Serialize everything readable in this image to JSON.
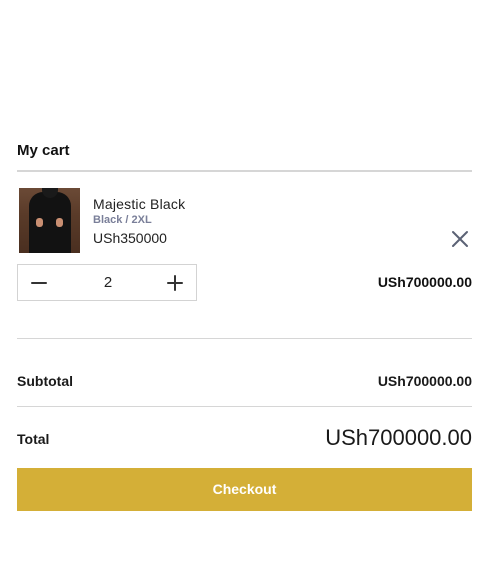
{
  "cart": {
    "title": "My cart"
  },
  "item": {
    "name": "Majestic Black",
    "variant": "Black / 2XL",
    "unit_price": "USh350000",
    "quantity": "2",
    "line_total": "USh700000.00",
    "image_icon": "product-thumbnail",
    "remove_icon": "close-icon"
  },
  "stepper": {
    "decrease_icon": "minus-icon",
    "increase_icon": "plus-icon"
  },
  "summary": {
    "subtotal_label": "Subtotal",
    "subtotal_value": "USh700000.00",
    "total_label": "Total",
    "total_value": "USh700000.00"
  },
  "checkout": {
    "label": "Checkout",
    "color": "#d4af37"
  }
}
